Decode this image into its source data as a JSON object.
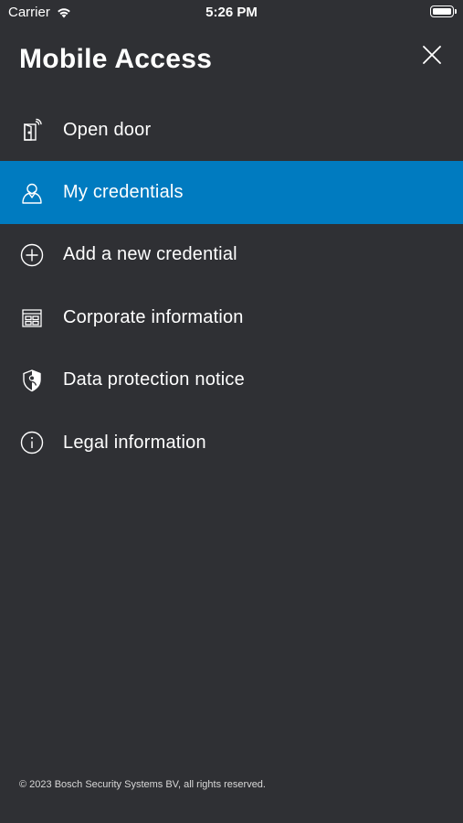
{
  "status_bar": {
    "carrier": "Carrier",
    "time": "5:26 PM"
  },
  "header": {
    "title": "Mobile Access"
  },
  "menu": {
    "items": [
      {
        "label": "Open door",
        "icon": "door-icon"
      },
      {
        "label": "My credentials",
        "icon": "credentials-icon",
        "active": true
      },
      {
        "label": "Add a new credential",
        "icon": "plus-circle-icon"
      },
      {
        "label": "Corporate information",
        "icon": "building-icon"
      },
      {
        "label": "Data protection notice",
        "icon": "shield-icon"
      },
      {
        "label": "Legal information",
        "icon": "info-icon"
      }
    ]
  },
  "footer": {
    "copyright": "© 2023 Bosch Security Systems BV, all rights reserved."
  },
  "colors": {
    "background": "#2f3034",
    "active": "#007bc0",
    "text": "#ffffff"
  }
}
